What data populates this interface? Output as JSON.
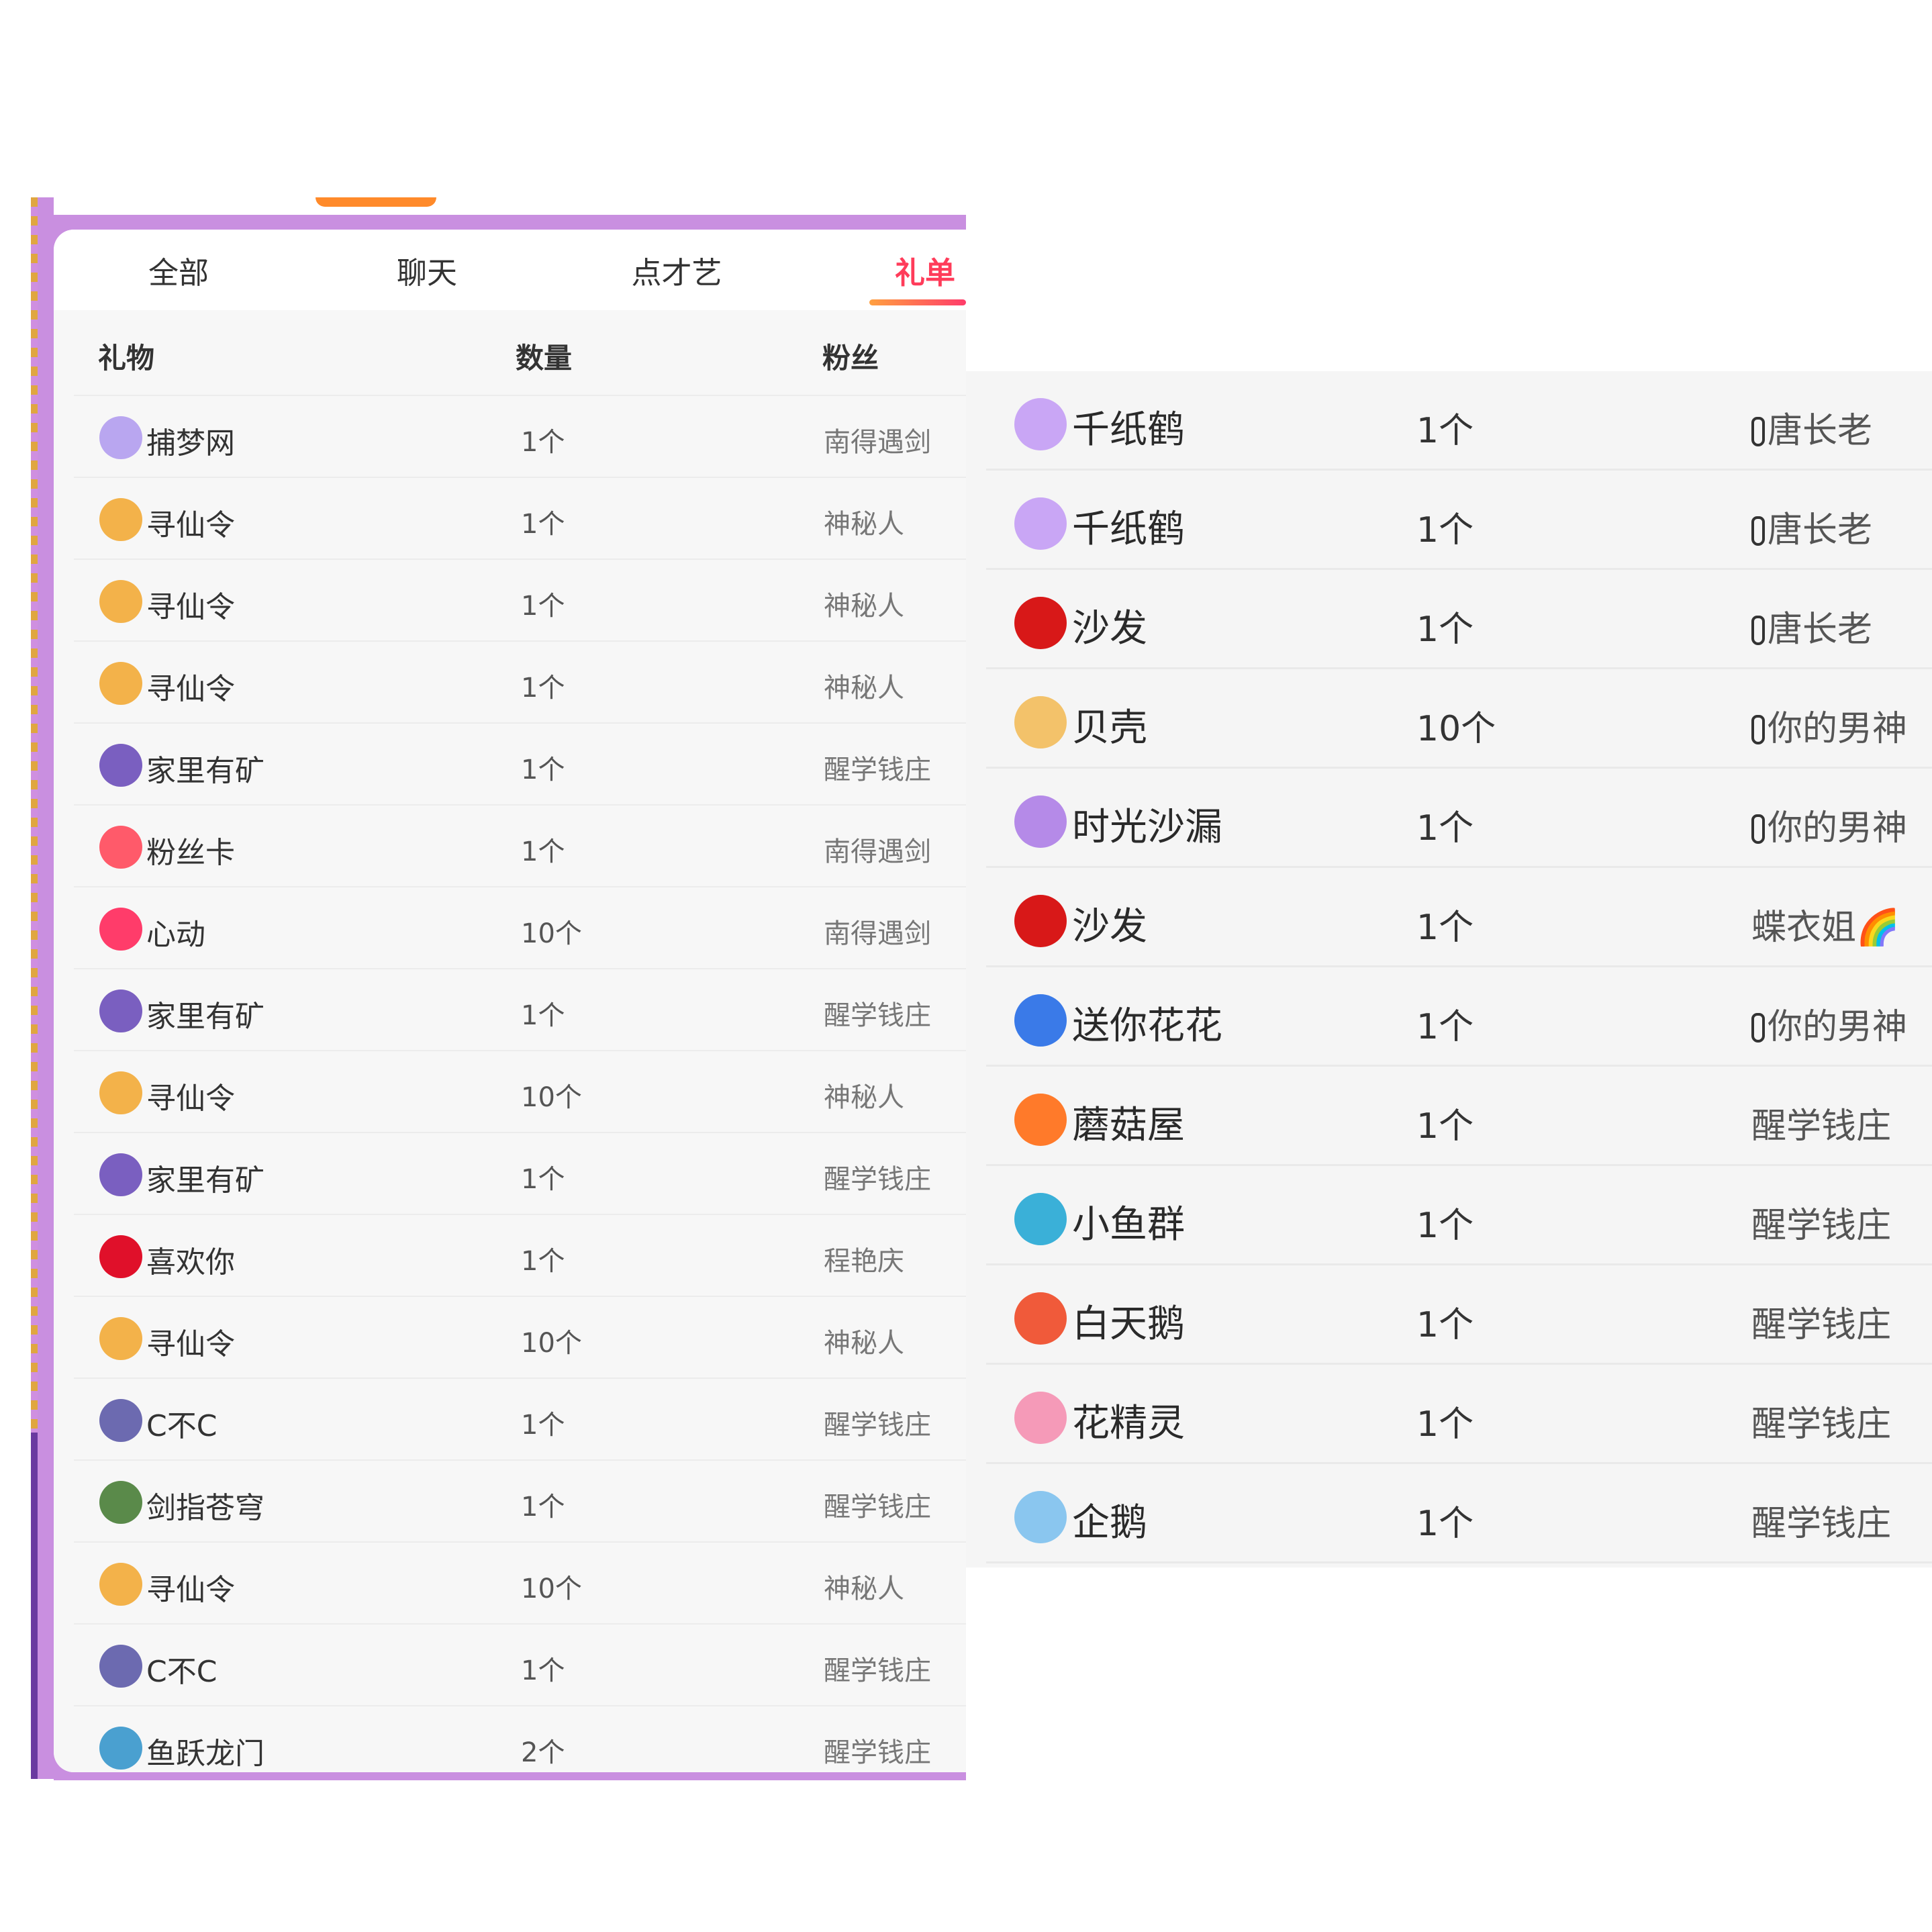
{
  "tabs": [
    {
      "label": "全部"
    },
    {
      "label": "聊天"
    },
    {
      "label": "点才艺"
    },
    {
      "label": "礼单",
      "active": true
    }
  ],
  "table": {
    "headers": {
      "gift": "礼物",
      "qty": "数量",
      "fan": "粉丝"
    }
  },
  "left_rows": [
    {
      "icon": "dreamcatcher-icon",
      "color": "#b9a6f0",
      "gift": "捕梦网",
      "qty": "1个",
      "fan": "南得遇剑"
    },
    {
      "icon": "immortal-token-icon",
      "color": "#f3b24a",
      "gift": "寻仙令",
      "qty": "1个",
      "fan": "神秘人"
    },
    {
      "icon": "immortal-token-icon",
      "color": "#f3b24a",
      "gift": "寻仙令",
      "qty": "1个",
      "fan": "神秘人"
    },
    {
      "icon": "immortal-token-icon",
      "color": "#f3b24a",
      "gift": "寻仙令",
      "qty": "1个",
      "fan": "神秘人"
    },
    {
      "icon": "mine-icon",
      "color": "#7a5fc0",
      "gift": "家里有矿",
      "qty": "1个",
      "fan": "醒学钱庄"
    },
    {
      "icon": "fan-card-icon",
      "color": "#ff5a6a",
      "gift": "粉丝卡",
      "qty": "1个",
      "fan": "南得遇剑"
    },
    {
      "icon": "heart-icon",
      "color": "#ff3c6a",
      "gift": "心动",
      "qty": "10个",
      "fan": "南得遇剑"
    },
    {
      "icon": "mine-icon",
      "color": "#7a5fc0",
      "gift": "家里有矿",
      "qty": "1个",
      "fan": "醒学钱庄"
    },
    {
      "icon": "immortal-token-icon",
      "color": "#f3b24a",
      "gift": "寻仙令",
      "qty": "10个",
      "fan": "神秘人"
    },
    {
      "icon": "mine-icon",
      "color": "#7a5fc0",
      "gift": "家里有矿",
      "qty": "1个",
      "fan": "醒学钱庄"
    },
    {
      "icon": "love-heart-icon",
      "color": "#e0102a",
      "gift": "喜欢你",
      "qty": "1个",
      "fan": "程艳庆"
    },
    {
      "icon": "immortal-token-icon",
      "color": "#f3b24a",
      "gift": "寻仙令",
      "qty": "10个",
      "fan": "神秘人"
    },
    {
      "icon": "character-icon",
      "color": "#6c6ab0",
      "gift": "C不C",
      "qty": "1个",
      "fan": "醒学钱庄"
    },
    {
      "icon": "swordsman-icon",
      "color": "#5a8a4a",
      "gift": "剑指苍穹",
      "qty": "1个",
      "fan": "醒学钱庄"
    },
    {
      "icon": "immortal-token-icon",
      "color": "#f3b24a",
      "gift": "寻仙令",
      "qty": "10个",
      "fan": "神秘人"
    },
    {
      "icon": "character-icon",
      "color": "#6c6ab0",
      "gift": "C不C",
      "qty": "1个",
      "fan": "醒学钱庄"
    },
    {
      "icon": "fish-dragon-gate-icon",
      "color": "#4aa0d0",
      "gift": "鱼跃龙门",
      "qty": "2个",
      "fan": "醒学钱庄"
    }
  ],
  "right_rows": [
    {
      "icon": "paper-crane-icon",
      "color": "#c9a6f5",
      "gift": "千纸鹤",
      "qty": "1个",
      "fan": "唐长老",
      "badge": true
    },
    {
      "icon": "paper-crane-icon",
      "color": "#c9a6f5",
      "gift": "千纸鹤",
      "qty": "1个",
      "fan": "唐长老",
      "badge": true
    },
    {
      "icon": "sofa-icon",
      "color": "#d81818",
      "gift": "沙发",
      "qty": "1个",
      "fan": "唐长老",
      "badge": true
    },
    {
      "icon": "shell-icon",
      "color": "#f3c26a",
      "gift": "贝壳",
      "qty": "10个",
      "fan": "你的男神",
      "badge": true
    },
    {
      "icon": "hourglass-icon",
      "color": "#b58ae8",
      "gift": "时光沙漏",
      "qty": "1个",
      "fan": "你的男神",
      "badge": true
    },
    {
      "icon": "sofa-icon",
      "color": "#d81818",
      "gift": "沙发",
      "qty": "1个",
      "fan": "蝶衣姐🌈",
      "badge": false
    },
    {
      "icon": "flower-ghost-icon",
      "color": "#3a7ae8",
      "gift": "送你花花",
      "qty": "1个",
      "fan": "你的男神",
      "badge": true
    },
    {
      "icon": "mushroom-house-icon",
      "color": "#ff7a2a",
      "gift": "蘑菇屋",
      "qty": "1个",
      "fan": "醒学钱庄",
      "badge": false
    },
    {
      "icon": "fish-school-icon",
      "color": "#3ab0d8",
      "gift": "小鱼群",
      "qty": "1个",
      "fan": "醒学钱庄",
      "badge": false
    },
    {
      "icon": "swan-icon",
      "color": "#f05a3a",
      "gift": "白天鹅",
      "qty": "1个",
      "fan": "醒学钱庄",
      "badge": false
    },
    {
      "icon": "flower-fairy-icon",
      "color": "#f59ab8",
      "gift": "花精灵",
      "qty": "1个",
      "fan": "醒学钱庄",
      "badge": false
    },
    {
      "icon": "penguin-icon",
      "color": "#8ac6ef",
      "gift": "企鹅",
      "qty": "1个",
      "fan": "醒学钱庄",
      "badge": false
    }
  ],
  "colors": {
    "accent": "#ff3c5a",
    "panel_border": "#c98fe0"
  }
}
